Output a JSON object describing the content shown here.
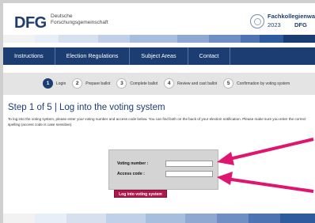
{
  "header": {
    "logo_text": "DFG",
    "org_name_line1": "Deutsche",
    "org_name_line2": "Forschungsgemeinschaft",
    "election_title": "Fachkollegienwahl",
    "election_year": "2023",
    "election_logo_text": "DFG"
  },
  "nav": {
    "items": [
      {
        "label": "Instructions"
      },
      {
        "label": "Election Regulations"
      },
      {
        "label": "Subject Areas"
      },
      {
        "label": "Contact"
      }
    ]
  },
  "steps": [
    {
      "num": "1",
      "label": "Login",
      "active": true
    },
    {
      "num": "2",
      "label": "Prepare ballot",
      "active": false
    },
    {
      "num": "3",
      "label": "Complete ballot",
      "active": false
    },
    {
      "num": "4",
      "label": "Review and cast ballot",
      "active": false
    },
    {
      "num": "5",
      "label": "Confirmation by voting system",
      "active": false
    }
  ],
  "main": {
    "heading": "Step 1 of 5  | Log into the voting system",
    "intro": "To log into the voting system, please enter your voting number and access code below. You can find both on the back of your election notification. Please make sure you enter the correct spelling (access code is case sensitive)."
  },
  "login": {
    "voting_number_label": "Voting number :",
    "voting_number_value": "",
    "access_code_label": "Access code :",
    "access_code_value": "",
    "button_label": "Log into voting system"
  },
  "colors": {
    "nav_bg": "#1c3d72",
    "button_bg": "#b0174a",
    "arrow": "#e0156f",
    "heading": "#1c3d72"
  }
}
